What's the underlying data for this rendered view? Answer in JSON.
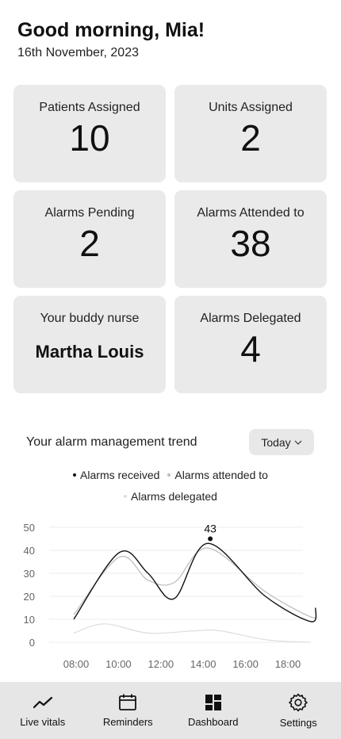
{
  "header": {
    "greeting": "Good morning, Mia!",
    "date": "16th November, 2023"
  },
  "stats": {
    "patients_assigned": {
      "label": "Patients Assigned",
      "value": "10"
    },
    "units_assigned": {
      "label": "Units Assigned",
      "value": "2"
    },
    "alarms_pending": {
      "label": "Alarms Pending",
      "value": "2"
    },
    "alarms_attended": {
      "label": "Alarms Attended to",
      "value": "38"
    },
    "buddy_nurse": {
      "label": "Your buddy nurse",
      "value": "Martha Louis"
    },
    "alarms_delegated": {
      "label": "Alarms Delegated",
      "value": "4"
    }
  },
  "trend": {
    "title": "Your alarm management trend",
    "period_select": "Today"
  },
  "chart_data": {
    "type": "line",
    "x": [
      "08:00",
      "10:00",
      "12:00",
      "14:00",
      "16:00",
      "18:00"
    ],
    "ylim": [
      0,
      50
    ],
    "yticks": [
      0,
      10,
      20,
      30,
      40,
      50
    ],
    "xticks": [
      "08:00",
      "10:00",
      "12:00",
      "14:00",
      "16:00",
      "18:00"
    ],
    "grid": true,
    "legend_position": "top",
    "series": [
      {
        "name": "Alarms received",
        "color": "#111111",
        "points": [
          [
            7.9,
            10
          ],
          [
            9.8,
            39
          ],
          [
            11.0,
            30
          ],
          [
            12.1,
            19
          ],
          [
            13.5,
            43
          ],
          [
            15.9,
            20
          ],
          [
            17.8,
            9
          ],
          [
            18.0,
            15
          ]
        ]
      },
      {
        "name": "Alarms attended to",
        "color": "#bbbbbb",
        "points": [
          [
            7.9,
            12
          ],
          [
            9.8,
            37
          ],
          [
            11.0,
            27
          ],
          [
            12.1,
            26
          ],
          [
            13.5,
            41
          ],
          [
            15.9,
            22
          ],
          [
            17.8,
            11
          ],
          [
            18.0,
            13
          ]
        ]
      },
      {
        "name": "Alarms delegated",
        "color": "#dddddd",
        "points": [
          [
            7.9,
            4
          ],
          [
            9.2,
            8
          ],
          [
            11.0,
            4
          ],
          [
            13.0,
            5
          ],
          [
            14.0,
            5
          ],
          [
            16.0,
            1
          ],
          [
            17.8,
            0
          ]
        ]
      }
    ],
    "annotations": [
      {
        "x": 13.6,
        "y": 45,
        "label": "43"
      }
    ]
  },
  "nav": {
    "items": [
      {
        "label": "Live vitals",
        "icon": "trend-icon"
      },
      {
        "label": "Reminders",
        "icon": "calendar-icon"
      },
      {
        "label": "Dashboard",
        "icon": "dashboard-icon"
      },
      {
        "label": "Settings",
        "icon": "gear-icon"
      }
    ]
  }
}
